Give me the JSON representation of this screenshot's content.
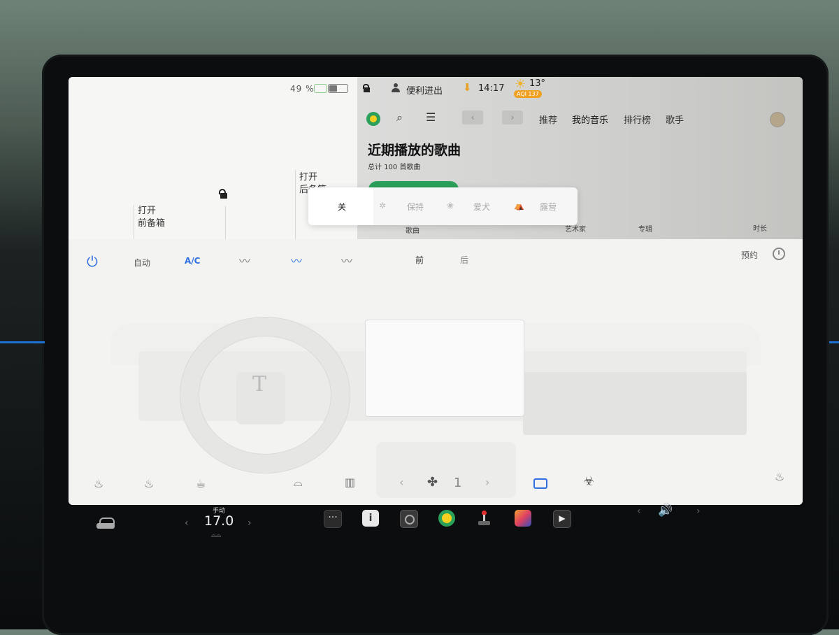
{
  "status_bar": {
    "battery_percent": "49 %",
    "mode_label": "便利进出",
    "time": "14:17",
    "weather_temp": "13°",
    "aqi_badge": "AQI 137",
    "battery_level": 0.49
  },
  "car_panel": {
    "front_trunk": {
      "line1": "打开",
      "line2": "前备箱"
    },
    "rear_trunk": {
      "line1": "打开",
      "line2": "后备箱"
    }
  },
  "music": {
    "nav_tabs": [
      "推荐",
      "我的音乐",
      "排行榜",
      "歌手"
    ],
    "section_title": "近期播放的歌曲",
    "song_count": "总计 100 首歌曲",
    "columns": {
      "song": "歌曲",
      "artist": "艺术家",
      "album": "专辑",
      "duration": "时长"
    }
  },
  "climate_mode_popup": {
    "options": [
      "关",
      "保持",
      "爱犬",
      "露营"
    ],
    "selected": "关"
  },
  "climate": {
    "auto_label": "自动",
    "ac_label": "A/C",
    "front_label": "前",
    "rear_label": "后",
    "schedule_label": "预约",
    "fan_speed": "1"
  },
  "taskbar": {
    "temp_mode": "手动",
    "temperature": "17.0"
  },
  "colors": {
    "accent_blue": "#2f6fe0",
    "music_green": "#2aa05a",
    "aqi_orange": "#f0a020"
  }
}
